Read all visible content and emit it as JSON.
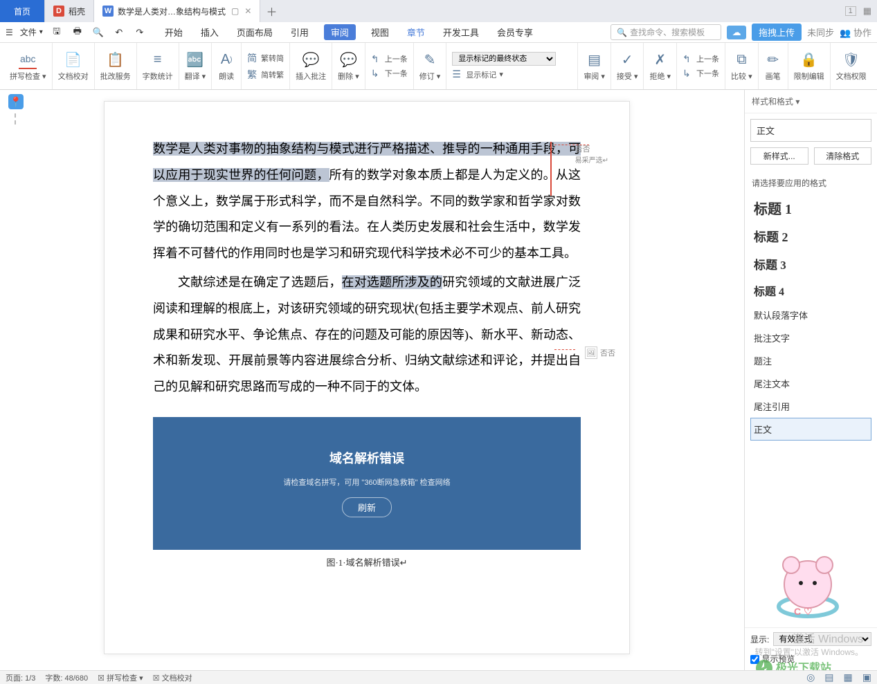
{
  "tabs": {
    "home": "首页",
    "shell": "稻壳",
    "doc": "数学是人类对…象结构与模式",
    "doc_icon": "W",
    "shell_icon": "D"
  },
  "titlebar_right": {
    "window_num": "1",
    "collab": "协作"
  },
  "menubar": {
    "file": "文件",
    "tabs": [
      "开始",
      "插入",
      "页面布局",
      "引用",
      "审阅",
      "视图",
      "章节",
      "开发工具",
      "会员专享"
    ],
    "active_tab": "审阅",
    "blue_tab": "章节",
    "search_placeholder": "查找命令、搜索模板",
    "cloud_btn": "拖拽上传",
    "sync": "未同步"
  },
  "ribbon": {
    "spell": "拼写检查",
    "proof": "文档校对",
    "approve": "批改服务",
    "wordcount": "字数统计",
    "translate": "翻译",
    "read": "朗读",
    "convert1": "繁转简",
    "convert2": "简转繁",
    "insert_comment": "插入批注",
    "delete_comment": "删除",
    "prev": "上一条",
    "next": "下一条",
    "revise": "修订",
    "show_label": "显示标记",
    "state_select": "显示标记的最终状态",
    "review_pane": "审阅",
    "accept": "接受",
    "reject": "拒绝",
    "rprev": "上一条",
    "rnext": "下一条",
    "compare": "比较",
    "brush": "画笔",
    "limit": "限制编辑",
    "perm": "文档权限"
  },
  "doc": {
    "p1_hl": "数学是人类对事物的抽象结构与模式进行严格描述、推导的一种通用手段，可以应用于现实世界的任何问题，",
    "p1_rest": "所有的数学对象本质上都是人为定义的。从这个意义上，数学属于形式科学，而不是自然科学。不同的数学家和哲学家对数学的确切范围和定义有一系列的看法。在人类历史发展和社会生活中，数学发挥着不可替代的作用同时也是学习和研究现代科学技术必不可少的基本工具。",
    "p2a": "文献综述是在确定了选题后，",
    "p2_hl": "在对选题所涉及的",
    "p2b": "研究领域的文献进展广泛阅读和理解的根底上，对该研究领域的研究现状(包括主要学术观点、前人研究成果和研究水平、争论焦点、存在的问题及可能的原因等)、新水平、新动态、术和新发现、开展前景等内容进展综合分析、归纳文献综述和评论，并提出自己的见解和研究思路而写成的一种不同于的文体。",
    "annot_user": "否否",
    "annot_prod": "易采严选",
    "embed_title": "域名解析错误",
    "embed_sub": "请检查域名拼写，可用 \"360断网急救箱\" 检查网络",
    "embed_btn": "刷新",
    "caption": "图·1·域名解析错误↵"
  },
  "side": {
    "header": "样式和格式",
    "current": "正文",
    "new_style": "新样式...",
    "clear": "清除格式",
    "choose": "请选择要应用的格式",
    "items": [
      "标题 1",
      "标题 2",
      "标题 3",
      "标题 4",
      "默认段落字体",
      "批注文字",
      "题注",
      "尾注文本",
      "尾注引用",
      "正文"
    ],
    "show_label": "显示:",
    "show_value": "有效样式",
    "preview": "显示预览"
  },
  "status": {
    "page": "页面: 1/3",
    "words": "字数: 48/680",
    "spellcheck": "拼写检查",
    "doccheck": "文档校对"
  },
  "watermark": {
    "line1": "激活 Windows",
    "line2": "转到\"设置\"以激活 Windows。"
  },
  "site": "极光下载站"
}
